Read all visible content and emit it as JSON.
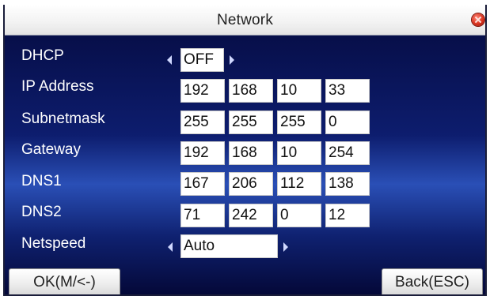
{
  "title": "Network",
  "fields": {
    "dhcp": {
      "label": "DHCP",
      "value": "OFF"
    },
    "ip": {
      "label": "IP Address",
      "values": [
        "192",
        "168",
        "10",
        "33"
      ]
    },
    "subnet": {
      "label": "Subnetmask",
      "values": [
        "255",
        "255",
        "255",
        "0"
      ]
    },
    "gateway": {
      "label": "Gateway",
      "values": [
        "192",
        "168",
        "10",
        "254"
      ]
    },
    "dns1": {
      "label": "DNS1",
      "values": [
        "167",
        "206",
        "112",
        "138"
      ]
    },
    "dns2": {
      "label": "DNS2",
      "values": [
        "71",
        "242",
        "0",
        "12"
      ]
    },
    "netspeed": {
      "label": "Netspeed",
      "value": "Auto"
    }
  },
  "buttons": {
    "ok": "OK(M/<-)",
    "back": "Back(ESC)"
  },
  "icons": {
    "close": "close-icon",
    "prev": "arrow-left-icon",
    "next": "arrow-right-icon"
  },
  "colors": {
    "close": "#d8321e",
    "background_top": "#050a3e",
    "background_mid": "#2a4fb6"
  }
}
